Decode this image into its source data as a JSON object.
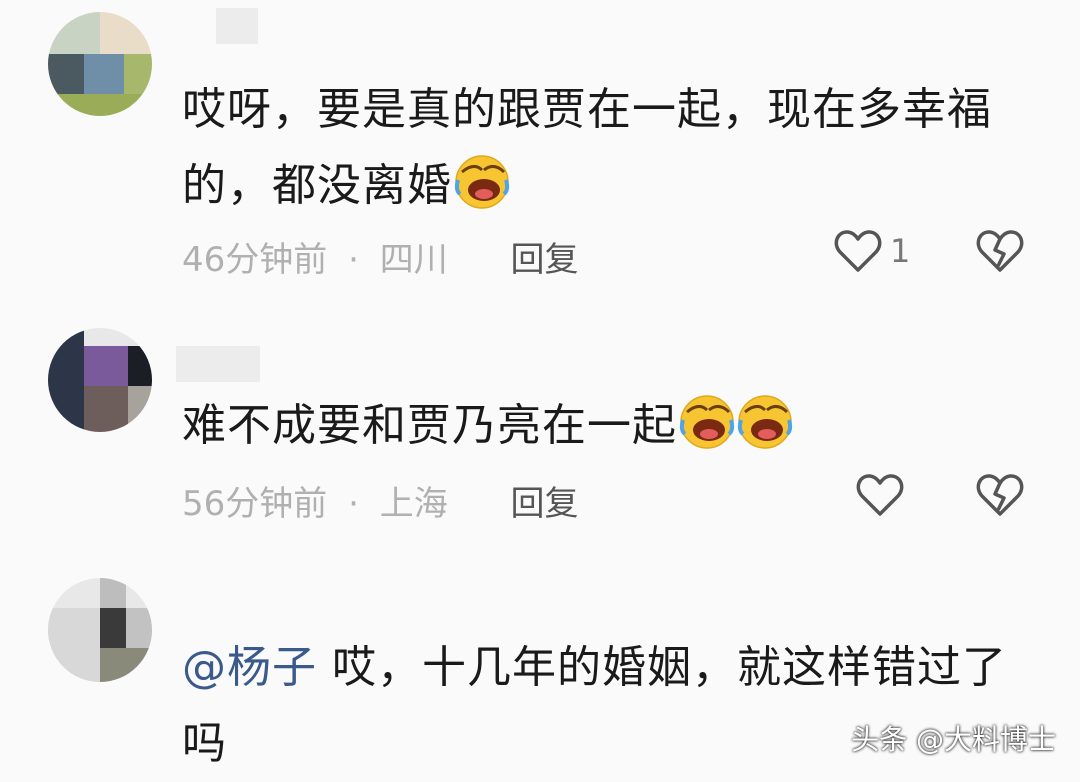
{
  "comments": [
    {
      "text": "哎呀，要是真的跟贾在一起，现在多幸福的，都没离婚",
      "time": "46分钟前",
      "sep": "·",
      "location": "四川",
      "reply": "回复",
      "likes": "1",
      "emoji": "rofl-emoji"
    },
    {
      "text": "难不成要和贾乃亮在一起",
      "time": "56分钟前",
      "sep": "·",
      "location": "上海",
      "reply": "回复",
      "likes": "",
      "emoji": "rofl-emoji"
    },
    {
      "mention": "@杨子",
      "text": "哎，十几年的婚姻，就这样错过了吗"
    }
  ],
  "watermark": "头条 @大料博士",
  "colors": {
    "accent_mention": "#3a5a8c",
    "meta_gray": "#b0b0b0"
  },
  "icons": {
    "like": "heart-outline-icon",
    "dislike": "broken-heart-icon"
  }
}
